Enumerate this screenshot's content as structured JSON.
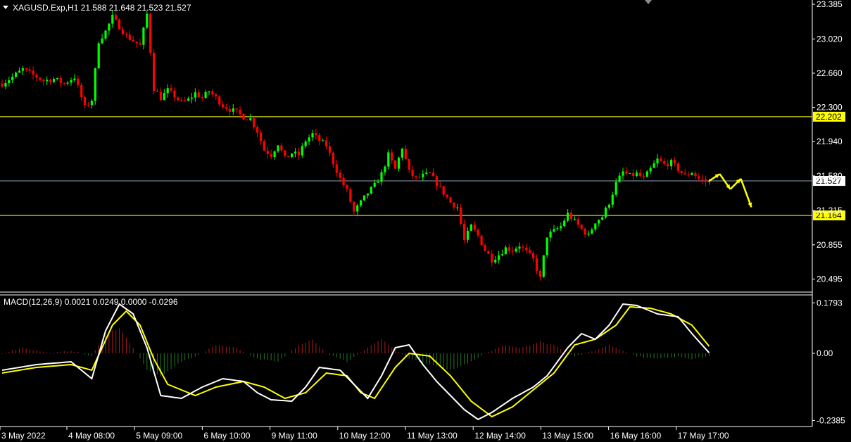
{
  "window": {
    "symbol_header": "XAGUSD.Exp,H1  21.588 21.648 21.523 21.527",
    "macd_header": "MACD(12,26,9) 0.0021 0.0249 0.0000 -0.0296"
  },
  "colors": {
    "background": "#000000",
    "bull_candle": "#00ff00",
    "bear_candle": "#ff0000",
    "level_line": "#ffff00",
    "macd_line": "#ffffff",
    "signal_line": "#ffff00",
    "hist_up": "#b01818",
    "hist_down": "#1e7a1e",
    "arrow": "#ffff00",
    "price_line": "#8da0b8"
  },
  "chart_data": {
    "type": "candlestick",
    "symbol": "XAGUSD.Exp",
    "timeframe": "H1",
    "price_axis": {
      "ticks": [
        "23.385",
        "23.020",
        "22.660",
        "22.300",
        "21.940",
        "21.580",
        "21.215",
        "20.855",
        "20.495"
      ],
      "ylim": [
        20.38,
        23.4
      ]
    },
    "levels": [
      {
        "value": 22.202,
        "label": "22.202"
      },
      {
        "value": 21.164,
        "label": "21.164"
      }
    ],
    "current_price": {
      "value": 21.527,
      "label": "21.527"
    },
    "time_axis": [
      "3 May 2022",
      "4 May 08:00",
      "5 May 09:00",
      "6 May 10:00",
      "9 May 11:00",
      "10 May 12:00",
      "11 May 13:00",
      "12 May 14:00",
      "13 May 15:00",
      "16 May 16:00",
      "17 May 17:00"
    ],
    "close_path": [
      [
        0,
        22.55
      ],
      [
        3,
        22.62
      ],
      [
        6,
        22.7
      ],
      [
        9,
        22.64
      ],
      [
        12,
        22.58
      ],
      [
        15,
        22.6
      ],
      [
        18,
        22.55
      ],
      [
        21,
        22.62
      ],
      [
        24,
        22.3
      ],
      [
        26,
        22.38
      ],
      [
        28,
        23.0
      ],
      [
        30,
        23.1
      ],
      [
        32,
        23.25
      ],
      [
        34,
        23.15
      ],
      [
        36,
        23.05
      ],
      [
        38,
        23.0
      ],
      [
        40,
        22.95
      ],
      [
        42,
        23.28
      ],
      [
        44,
        22.5
      ],
      [
        46,
        22.4
      ],
      [
        48,
        22.48
      ],
      [
        50,
        22.42
      ],
      [
        52,
        22.35
      ],
      [
        54,
        22.38
      ],
      [
        56,
        22.45
      ],
      [
        58,
        22.4
      ],
      [
        60,
        22.47
      ],
      [
        62,
        22.4
      ],
      [
        64,
        22.32
      ],
      [
        66,
        22.28
      ],
      [
        68,
        22.25
      ],
      [
        70,
        22.2
      ],
      [
        72,
        22.18
      ],
      [
        74,
        22.05
      ],
      [
        76,
        21.85
      ],
      [
        78,
        21.8
      ],
      [
        80,
        21.92
      ],
      [
        82,
        21.76
      ],
      [
        84,
        21.82
      ],
      [
        86,
        21.8
      ],
      [
        88,
        21.95
      ],
      [
        90,
        22.02
      ],
      [
        92,
        21.95
      ],
      [
        94,
        21.9
      ],
      [
        96,
        21.72
      ],
      [
        98,
        21.55
      ],
      [
        100,
        21.42
      ],
      [
        102,
        21.2
      ],
      [
        104,
        21.3
      ],
      [
        106,
        21.4
      ],
      [
        108,
        21.48
      ],
      [
        110,
        21.6
      ],
      [
        112,
        21.8
      ],
      [
        114,
        21.65
      ],
      [
        116,
        21.88
      ],
      [
        118,
        21.62
      ],
      [
        120,
        21.55
      ],
      [
        122,
        21.58
      ],
      [
        124,
        21.6
      ],
      [
        126,
        21.5
      ],
      [
        128,
        21.4
      ],
      [
        130,
        21.3
      ],
      [
        132,
        21.25
      ],
      [
        134,
        20.9
      ],
      [
        136,
        21.05
      ],
      [
        138,
        20.95
      ],
      [
        140,
        20.8
      ],
      [
        142,
        20.7
      ],
      [
        144,
        20.75
      ],
      [
        146,
        20.82
      ],
      [
        148,
        20.8
      ],
      [
        150,
        20.85
      ],
      [
        152,
        20.78
      ],
      [
        154,
        20.7
      ],
      [
        156,
        20.5
      ],
      [
        158,
        20.95
      ],
      [
        160,
        21.0
      ],
      [
        162,
        21.05
      ],
      [
        164,
        21.18
      ],
      [
        166,
        21.1
      ],
      [
        168,
        21.02
      ],
      [
        170,
        20.95
      ],
      [
        172,
        21.1
      ],
      [
        174,
        21.15
      ],
      [
        176,
        21.3
      ],
      [
        178,
        21.5
      ],
      [
        180,
        21.62
      ],
      [
        182,
        21.58
      ],
      [
        184,
        21.6
      ],
      [
        186,
        21.55
      ],
      [
        188,
        21.65
      ],
      [
        190,
        21.75
      ],
      [
        192,
        21.7
      ],
      [
        194,
        21.72
      ],
      [
        196,
        21.65
      ],
      [
        198,
        21.58
      ],
      [
        200,
        21.62
      ],
      [
        202,
        21.55
      ],
      [
        204,
        21.52
      ],
      [
        205,
        21.527
      ]
    ],
    "forecast_arrows": [
      [
        21.527,
        21.6
      ],
      [
        21.6,
        21.44
      ],
      [
        21.44,
        21.55
      ],
      [
        21.55,
        21.25
      ]
    ],
    "macd": {
      "axis_ticks": [
        "0.1793",
        "0.00",
        "-0.2385"
      ],
      "ylim": [
        -0.245,
        0.185
      ],
      "macd_path": [
        [
          0,
          -0.06
        ],
        [
          10,
          -0.04
        ],
        [
          20,
          -0.03
        ],
        [
          26,
          -0.09
        ],
        [
          30,
          0.08
        ],
        [
          34,
          0.175
        ],
        [
          38,
          0.14
        ],
        [
          42,
          0.02
        ],
        [
          46,
          -0.15
        ],
        [
          52,
          -0.16
        ],
        [
          58,
          -0.12
        ],
        [
          64,
          -0.09
        ],
        [
          70,
          -0.1
        ],
        [
          74,
          -0.14
        ],
        [
          78,
          -0.165
        ],
        [
          84,
          -0.17
        ],
        [
          88,
          -0.12
        ],
        [
          92,
          -0.05
        ],
        [
          98,
          -0.06
        ],
        [
          102,
          -0.11
        ],
        [
          106,
          -0.16
        ],
        [
          110,
          -0.08
        ],
        [
          114,
          0.02
        ],
        [
          118,
          0.03
        ],
        [
          122,
          -0.04
        ],
        [
          126,
          -0.1
        ],
        [
          130,
          -0.15
        ],
        [
          134,
          -0.2
        ],
        [
          138,
          -0.235
        ],
        [
          142,
          -0.21
        ],
        [
          148,
          -0.16
        ],
        [
          154,
          -0.12
        ],
        [
          158,
          -0.08
        ],
        [
          164,
          0.02
        ],
        [
          168,
          0.07
        ],
        [
          172,
          0.05
        ],
        [
          176,
          0.1
        ],
        [
          180,
          0.175
        ],
        [
          184,
          0.17
        ],
        [
          190,
          0.14
        ],
        [
          196,
          0.13
        ],
        [
          200,
          0.07
        ],
        [
          205,
          0.002
        ]
      ],
      "signal_path": [
        [
          0,
          -0.07
        ],
        [
          10,
          -0.05
        ],
        [
          20,
          -0.04
        ],
        [
          26,
          -0.06
        ],
        [
          32,
          0.1
        ],
        [
          36,
          0.15
        ],
        [
          40,
          0.1
        ],
        [
          44,
          -0.02
        ],
        [
          48,
          -0.11
        ],
        [
          56,
          -0.15
        ],
        [
          62,
          -0.12
        ],
        [
          70,
          -0.1
        ],
        [
          76,
          -0.12
        ],
        [
          82,
          -0.16
        ],
        [
          88,
          -0.14
        ],
        [
          94,
          -0.07
        ],
        [
          100,
          -0.08
        ],
        [
          104,
          -0.14
        ],
        [
          108,
          -0.16
        ],
        [
          114,
          -0.05
        ],
        [
          118,
          0.0
        ],
        [
          124,
          -0.01
        ],
        [
          130,
          -0.08
        ],
        [
          136,
          -0.17
        ],
        [
          142,
          -0.225
        ],
        [
          148,
          -0.19
        ],
        [
          154,
          -0.13
        ],
        [
          160,
          -0.07
        ],
        [
          166,
          0.03
        ],
        [
          172,
          0.05
        ],
        [
          178,
          0.1
        ],
        [
          182,
          0.165
        ],
        [
          188,
          0.16
        ],
        [
          194,
          0.14
        ],
        [
          200,
          0.1
        ],
        [
          205,
          0.025
        ]
      ],
      "hist_path": [
        [
          0,
          0.0
        ],
        [
          6,
          0.02
        ],
        [
          14,
          0.0
        ],
        [
          20,
          0.01
        ],
        [
          26,
          -0.01
        ],
        [
          30,
          0.07
        ],
        [
          34,
          0.09
        ],
        [
          38,
          0.02
        ],
        [
          42,
          -0.06
        ],
        [
          46,
          -0.08
        ],
        [
          52,
          -0.03
        ],
        [
          58,
          0.0
        ],
        [
          62,
          0.03
        ],
        [
          68,
          0.02
        ],
        [
          74,
          -0.02
        ],
        [
          80,
          -0.03
        ],
        [
          86,
          0.03
        ],
        [
          90,
          0.05
        ],
        [
          94,
          0.0
        ],
        [
          100,
          -0.03
        ],
        [
          106,
          0.02
        ],
        [
          110,
          0.05
        ],
        [
          114,
          0.01
        ],
        [
          118,
          -0.02
        ],
        [
          124,
          -0.04
        ],
        [
          130,
          -0.06
        ],
        [
          136,
          -0.03
        ],
        [
          142,
          0.01
        ],
        [
          146,
          0.03
        ],
        [
          150,
          0.02
        ],
        [
          156,
          0.04
        ],
        [
          160,
          0.03
        ],
        [
          166,
          -0.01
        ],
        [
          172,
          0.01
        ],
        [
          176,
          0.03
        ],
        [
          180,
          0.01
        ],
        [
          184,
          -0.01
        ],
        [
          190,
          -0.02
        ],
        [
          196,
          -0.01
        ],
        [
          200,
          -0.02
        ],
        [
          205,
          -0.01
        ]
      ]
    }
  }
}
